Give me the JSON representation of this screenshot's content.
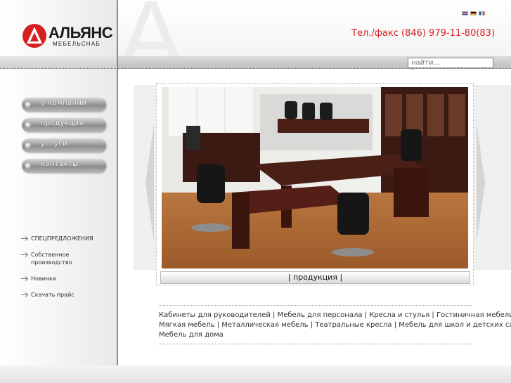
{
  "logo": {
    "name": "АЛЬЯНС",
    "subtitle": "МЕБЕЛЬСНАБ",
    "brand_color": "#d61f1f"
  },
  "header": {
    "phone": "Тел./факс (846) 979-11-80(83)",
    "languages": [
      "en",
      "de",
      "fr"
    ]
  },
  "search": {
    "placeholder": "найти..."
  },
  "nav": {
    "items": [
      {
        "label": "о компании"
      },
      {
        "label": "продукция"
      },
      {
        "label": "услуги"
      },
      {
        "label": "контакты"
      }
    ]
  },
  "sublinks": {
    "items": [
      {
        "label": "СПЕЦПРЕДЛОЖЕНИЯ"
      },
      {
        "label": "Собственное производство"
      },
      {
        "label": "Новинки"
      },
      {
        "label": "Скачать прайс"
      }
    ]
  },
  "main": {
    "caption": "| продукция |",
    "categories": {
      "line1": "Кабинеты для руководителей | Мебель для персонала | Кресла и стулья | Гостиничная мебель",
      "line2": "Мягкая мебель | Металлическая мебель | Театральные кресла | Мебель для школ и детских садов",
      "line3": "Мебель для дома"
    }
  },
  "colors": {
    "accent": "#d61f1f",
    "nav_pill": "#8d8d8d"
  }
}
